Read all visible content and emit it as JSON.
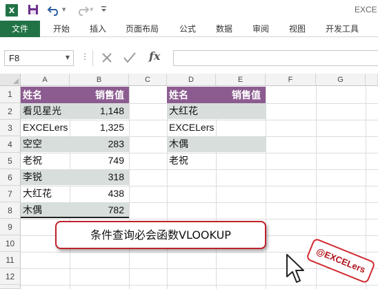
{
  "window": {
    "app_logo": "X",
    "title": "EXCE"
  },
  "quick_access": {
    "icons": [
      "excel-logo-icon",
      "save-icon",
      "undo-icon",
      "redo-icon",
      "customize-icon"
    ]
  },
  "ribbon": {
    "tabs": [
      "文件",
      "开始",
      "插入",
      "页面布局",
      "公式",
      "数据",
      "审阅",
      "视图",
      "开发工具"
    ]
  },
  "formula_bar": {
    "name_box": "F8",
    "formula": ""
  },
  "sheet": {
    "columns": [
      "A",
      "B",
      "C",
      "D",
      "E",
      "F",
      "G"
    ],
    "rows": [
      "1",
      "2",
      "3",
      "4",
      "5",
      "6",
      "7",
      "8",
      "9",
      "10",
      "11",
      "12"
    ],
    "table1": {
      "headers": [
        "姓名",
        "销售值"
      ],
      "rows": [
        [
          "看见星光",
          "1,148"
        ],
        [
          "EXCELers",
          "1,325"
        ],
        [
          "空空",
          "283"
        ],
        [
          "老祝",
          "749"
        ],
        [
          "李锐",
          "318"
        ],
        [
          "大红花",
          "438"
        ],
        [
          "木偶",
          "782"
        ]
      ]
    },
    "table2": {
      "headers": [
        "姓名",
        "销售值"
      ],
      "names": [
        "大红花",
        "EXCELers",
        "木偶",
        "老祝"
      ]
    }
  },
  "callout": "条件查询必会函数VLOOKUP",
  "stamp": "@EXCELers",
  "colors": {
    "excel_green": "#217346",
    "header_purple": "#8c5c90",
    "band_gray": "#d7dedc",
    "callout_border": "#c0202a"
  }
}
